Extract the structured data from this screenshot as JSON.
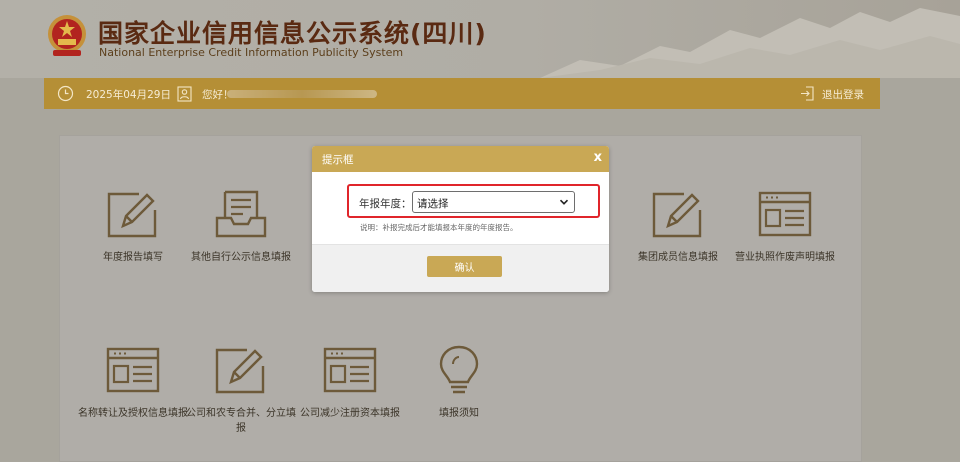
{
  "header": {
    "title_cn": "国家企业信用信息公示系统(四川)",
    "title_en": "National Enterprise Credit Information Publicity System"
  },
  "infobar": {
    "date": "2025年04月29日",
    "greeting": "您好！",
    "logout": "退出登录"
  },
  "tiles": [
    {
      "label": "年度报告填写",
      "icon": "edit-icon"
    },
    {
      "label": "其他自行公示信息填报",
      "icon": "inbox-icon"
    },
    {
      "label": "集团成员信息填报",
      "icon": "edit-icon"
    },
    {
      "label": "营业执照作废声明填报",
      "icon": "form-icon"
    },
    {
      "label": "名称转让及授权信息填报",
      "icon": "form-icon"
    },
    {
      "label": "公司和农专合并、分立填报",
      "icon": "edit-icon"
    },
    {
      "label": "公司减少注册资本填报",
      "icon": "form-icon"
    },
    {
      "label": "填报须知",
      "icon": "lightbulb-icon"
    }
  ],
  "modal": {
    "title": "提示框",
    "close": "x",
    "year_label": "年报年度：",
    "year_value": "请选择",
    "note": "说明：补报完成后才能填报本年度的年度报告。",
    "confirm": "确认"
  },
  "colors": {
    "gold": "#b58f36",
    "modal_header": "#c9a855",
    "highlight": "#e0252b",
    "title": "#5a2a12"
  }
}
